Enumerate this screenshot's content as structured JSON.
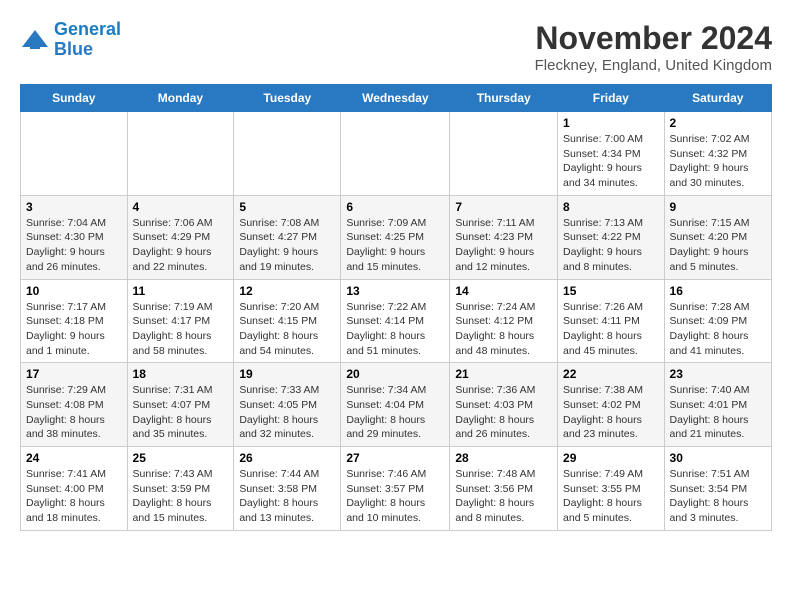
{
  "header": {
    "logo_line1": "General",
    "logo_line2": "Blue",
    "month_title": "November 2024",
    "location": "Fleckney, England, United Kingdom"
  },
  "weekdays": [
    "Sunday",
    "Monday",
    "Tuesday",
    "Wednesday",
    "Thursday",
    "Friday",
    "Saturday"
  ],
  "weeks": [
    [
      {
        "day": "",
        "info": ""
      },
      {
        "day": "",
        "info": ""
      },
      {
        "day": "",
        "info": ""
      },
      {
        "day": "",
        "info": ""
      },
      {
        "day": "",
        "info": ""
      },
      {
        "day": "1",
        "info": "Sunrise: 7:00 AM\nSunset: 4:34 PM\nDaylight: 9 hours\nand 34 minutes."
      },
      {
        "day": "2",
        "info": "Sunrise: 7:02 AM\nSunset: 4:32 PM\nDaylight: 9 hours\nand 30 minutes."
      }
    ],
    [
      {
        "day": "3",
        "info": "Sunrise: 7:04 AM\nSunset: 4:30 PM\nDaylight: 9 hours\nand 26 minutes."
      },
      {
        "day": "4",
        "info": "Sunrise: 7:06 AM\nSunset: 4:29 PM\nDaylight: 9 hours\nand 22 minutes."
      },
      {
        "day": "5",
        "info": "Sunrise: 7:08 AM\nSunset: 4:27 PM\nDaylight: 9 hours\nand 19 minutes."
      },
      {
        "day": "6",
        "info": "Sunrise: 7:09 AM\nSunset: 4:25 PM\nDaylight: 9 hours\nand 15 minutes."
      },
      {
        "day": "7",
        "info": "Sunrise: 7:11 AM\nSunset: 4:23 PM\nDaylight: 9 hours\nand 12 minutes."
      },
      {
        "day": "8",
        "info": "Sunrise: 7:13 AM\nSunset: 4:22 PM\nDaylight: 9 hours\nand 8 minutes."
      },
      {
        "day": "9",
        "info": "Sunrise: 7:15 AM\nSunset: 4:20 PM\nDaylight: 9 hours\nand 5 minutes."
      }
    ],
    [
      {
        "day": "10",
        "info": "Sunrise: 7:17 AM\nSunset: 4:18 PM\nDaylight: 9 hours\nand 1 minute."
      },
      {
        "day": "11",
        "info": "Sunrise: 7:19 AM\nSunset: 4:17 PM\nDaylight: 8 hours\nand 58 minutes."
      },
      {
        "day": "12",
        "info": "Sunrise: 7:20 AM\nSunset: 4:15 PM\nDaylight: 8 hours\nand 54 minutes."
      },
      {
        "day": "13",
        "info": "Sunrise: 7:22 AM\nSunset: 4:14 PM\nDaylight: 8 hours\nand 51 minutes."
      },
      {
        "day": "14",
        "info": "Sunrise: 7:24 AM\nSunset: 4:12 PM\nDaylight: 8 hours\nand 48 minutes."
      },
      {
        "day": "15",
        "info": "Sunrise: 7:26 AM\nSunset: 4:11 PM\nDaylight: 8 hours\nand 45 minutes."
      },
      {
        "day": "16",
        "info": "Sunrise: 7:28 AM\nSunset: 4:09 PM\nDaylight: 8 hours\nand 41 minutes."
      }
    ],
    [
      {
        "day": "17",
        "info": "Sunrise: 7:29 AM\nSunset: 4:08 PM\nDaylight: 8 hours\nand 38 minutes."
      },
      {
        "day": "18",
        "info": "Sunrise: 7:31 AM\nSunset: 4:07 PM\nDaylight: 8 hours\nand 35 minutes."
      },
      {
        "day": "19",
        "info": "Sunrise: 7:33 AM\nSunset: 4:05 PM\nDaylight: 8 hours\nand 32 minutes."
      },
      {
        "day": "20",
        "info": "Sunrise: 7:34 AM\nSunset: 4:04 PM\nDaylight: 8 hours\nand 29 minutes."
      },
      {
        "day": "21",
        "info": "Sunrise: 7:36 AM\nSunset: 4:03 PM\nDaylight: 8 hours\nand 26 minutes."
      },
      {
        "day": "22",
        "info": "Sunrise: 7:38 AM\nSunset: 4:02 PM\nDaylight: 8 hours\nand 23 minutes."
      },
      {
        "day": "23",
        "info": "Sunrise: 7:40 AM\nSunset: 4:01 PM\nDaylight: 8 hours\nand 21 minutes."
      }
    ],
    [
      {
        "day": "24",
        "info": "Sunrise: 7:41 AM\nSunset: 4:00 PM\nDaylight: 8 hours\nand 18 minutes."
      },
      {
        "day": "25",
        "info": "Sunrise: 7:43 AM\nSunset: 3:59 PM\nDaylight: 8 hours\nand 15 minutes."
      },
      {
        "day": "26",
        "info": "Sunrise: 7:44 AM\nSunset: 3:58 PM\nDaylight: 8 hours\nand 13 minutes."
      },
      {
        "day": "27",
        "info": "Sunrise: 7:46 AM\nSunset: 3:57 PM\nDaylight: 8 hours\nand 10 minutes."
      },
      {
        "day": "28",
        "info": "Sunrise: 7:48 AM\nSunset: 3:56 PM\nDaylight: 8 hours\nand 8 minutes."
      },
      {
        "day": "29",
        "info": "Sunrise: 7:49 AM\nSunset: 3:55 PM\nDaylight: 8 hours\nand 5 minutes."
      },
      {
        "day": "30",
        "info": "Sunrise: 7:51 AM\nSunset: 3:54 PM\nDaylight: 8 hours\nand 3 minutes."
      }
    ]
  ]
}
